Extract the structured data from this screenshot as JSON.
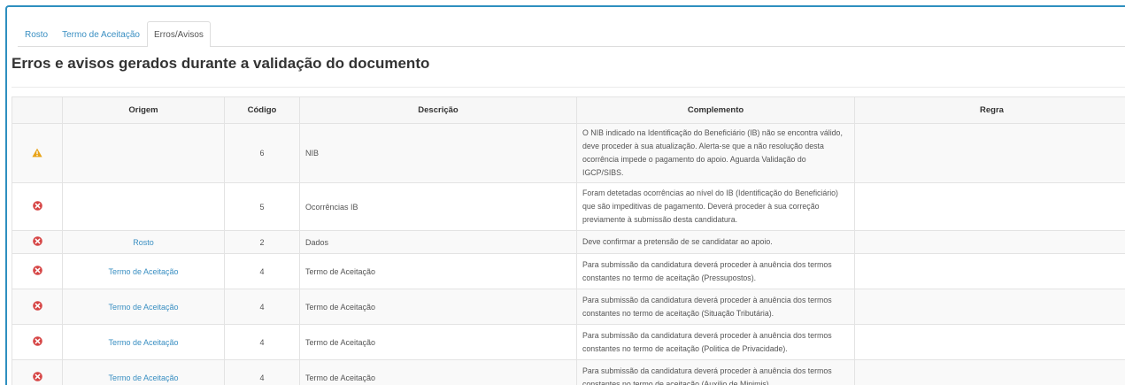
{
  "tabs": [
    {
      "label": "Rosto",
      "active": false
    },
    {
      "label": "Termo de Aceitação",
      "active": false
    },
    {
      "label": "Erros/Avisos",
      "active": true
    }
  ],
  "title": "Erros e avisos gerados durante a validação do documento",
  "table": {
    "headers": {
      "origem": "Origem",
      "codigo": "Código",
      "descricao": "Descrição",
      "complemento": "Complemento",
      "regra": "Regra"
    },
    "rows": [
      {
        "icon": "warning-icon",
        "origem": "",
        "codigo": "6",
        "descricao": "NIB",
        "complemento": "O NIB indicado na Identificação do Beneficiário (IB) não se encontra válido, deve proceder à sua atualização. Alerta-se que a não resolução desta ocorrência impede o pagamento do apoio. Aguarda Validação do IGCP/SIBS.",
        "regra": ""
      },
      {
        "icon": "error-icon",
        "origem": "",
        "codigo": "5",
        "descricao": "Ocorrências IB",
        "complemento": "Foram detetadas ocorrências ao nível do IB (Identificação do Beneficiário) que são impeditivas de pagamento. Deverá proceder à sua correção previamente à submissão desta candidatura.",
        "regra": ""
      },
      {
        "icon": "error-icon",
        "origem": "Rosto",
        "codigo": "2",
        "descricao": "Dados",
        "complemento": "Deve confirmar a pretensão de se candidatar ao apoio.",
        "regra": ""
      },
      {
        "icon": "error-icon",
        "origem": "Termo de Aceitação",
        "codigo": "4",
        "descricao": "Termo de Aceitação",
        "complemento": "Para submissão da candidatura deverá proceder à anuência dos termos constantes no termo de aceitação (Pressupostos).",
        "regra": ""
      },
      {
        "icon": "error-icon",
        "origem": "Termo de Aceitação",
        "codigo": "4",
        "descricao": "Termo de Aceitação",
        "complemento": "Para submissão da candidatura deverá proceder à anuência dos termos constantes no termo de aceitação (Situação Tributária).",
        "regra": ""
      },
      {
        "icon": "error-icon",
        "origem": "Termo de Aceitação",
        "codigo": "4",
        "descricao": "Termo de Aceitação",
        "complemento": "Para submissão da candidatura deverá proceder à anuência dos termos constantes no termo de aceitação (Politica de Privacidade).",
        "regra": ""
      },
      {
        "icon": "error-icon",
        "origem": "Termo de Aceitação",
        "codigo": "4",
        "descricao": "Termo de Aceitação",
        "complemento": "Para submissão da candidatura deverá proceder à anuência dos termos constantes no termo de aceitação (Auxilio de Minimis).",
        "regra": ""
      }
    ]
  },
  "colors": {
    "accent": "#2e8fbf",
    "link": "#3a8fc2",
    "error": "#d64545",
    "warning": "#e8a317"
  }
}
